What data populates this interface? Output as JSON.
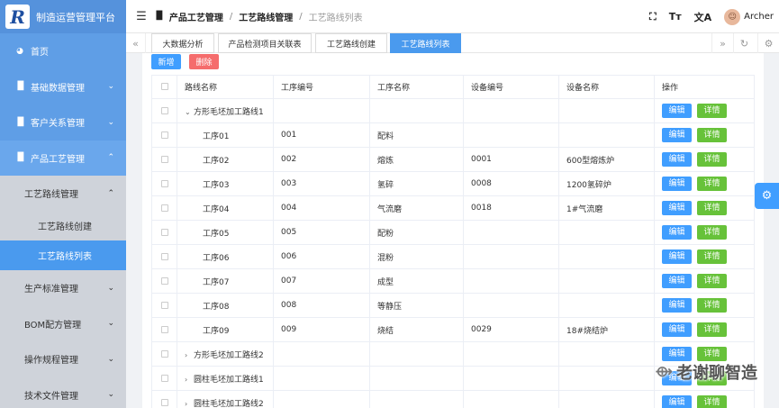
{
  "app": {
    "title": "制造运营管理平台",
    "logo_letter": "R"
  },
  "sidebar": {
    "items": [
      {
        "label": "首页",
        "icon": "dashboard-icon"
      },
      {
        "label": "基础数据管理",
        "icon": "bar-chart-icon"
      },
      {
        "label": "客户关系管理",
        "icon": "bar-chart-icon"
      },
      {
        "label": "产品工艺管理",
        "icon": "bar-chart-icon"
      }
    ],
    "submenu": {
      "label": "工艺路线管理",
      "children": [
        {
          "label": "工艺路线创建"
        },
        {
          "label": "工艺路线列表"
        }
      ]
    },
    "after_items": [
      {
        "label": "生产标准管理"
      },
      {
        "label": "BOM配方管理"
      },
      {
        "label": "操作规程管理"
      },
      {
        "label": "技术文件管理"
      }
    ]
  },
  "header": {
    "breadcrumb": [
      "产品工艺管理",
      "工艺路线管理",
      "工艺路线列表"
    ],
    "user": "Archer"
  },
  "tabs": [
    {
      "label": "大数据分析"
    },
    {
      "label": "产品检测项目关联表"
    },
    {
      "label": "工艺路线创建"
    },
    {
      "label": "工艺路线列表"
    }
  ],
  "toolbar": {
    "add_label": "新增",
    "delete_label": "删除"
  },
  "table": {
    "columns": [
      "路线名称",
      "工序编号",
      "工序名称",
      "设备编号",
      "设备名称",
      "操作"
    ],
    "edit_label": "编辑",
    "detail_label": "详情",
    "rows": [
      {
        "name": "方形毛坯加工路线1",
        "code": "",
        "proc": "",
        "dev_code": "",
        "dev_name": "",
        "level": 0,
        "expanded": true
      },
      {
        "name": "工序01",
        "code": "001",
        "proc": "配料",
        "dev_code": "",
        "dev_name": "",
        "level": 1
      },
      {
        "name": "工序02",
        "code": "002",
        "proc": "熔炼",
        "dev_code": "0001",
        "dev_name": "600型熔炼炉",
        "level": 1
      },
      {
        "name": "工序03",
        "code": "003",
        "proc": "氢碎",
        "dev_code": "0008",
        "dev_name": "1200氢碎炉",
        "level": 1
      },
      {
        "name": "工序04",
        "code": "004",
        "proc": "气流磨",
        "dev_code": "0018",
        "dev_name": "1#气流磨",
        "level": 1
      },
      {
        "name": "工序05",
        "code": "005",
        "proc": "配粉",
        "dev_code": "",
        "dev_name": "",
        "level": 1
      },
      {
        "name": "工序06",
        "code": "006",
        "proc": "混粉",
        "dev_code": "",
        "dev_name": "",
        "level": 1
      },
      {
        "name": "工序07",
        "code": "007",
        "proc": "成型",
        "dev_code": "",
        "dev_name": "",
        "level": 1
      },
      {
        "name": "工序08",
        "code": "008",
        "proc": "等静压",
        "dev_code": "",
        "dev_name": "",
        "level": 1
      },
      {
        "name": "工序09",
        "code": "009",
        "proc": "烧结",
        "dev_code": "0029",
        "dev_name": "18#烧结炉",
        "level": 1
      },
      {
        "name": "方形毛坯加工路线2",
        "code": "",
        "proc": "",
        "dev_code": "",
        "dev_name": "",
        "level": 0,
        "expanded": false
      },
      {
        "name": "圆柱毛坯加工路线1",
        "code": "",
        "proc": "",
        "dev_code": "",
        "dev_name": "",
        "level": 0,
        "expanded": false
      },
      {
        "name": "圆柱毛坯加工路线2",
        "code": "",
        "proc": "",
        "dev_code": "",
        "dev_name": "",
        "level": 0,
        "expanded": false
      }
    ]
  },
  "watermark": "老谢聊智造",
  "colors": {
    "sidebar": "#5f9ee6",
    "primary": "#409eff",
    "success": "#67c23a",
    "danger": "#f56c6c"
  }
}
